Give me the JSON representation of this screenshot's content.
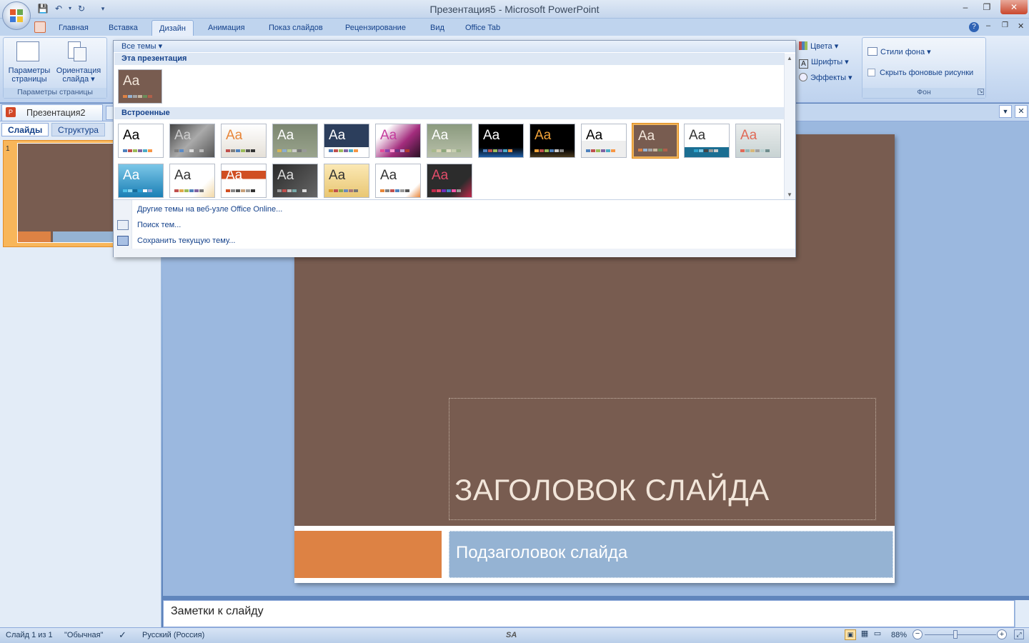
{
  "window": {
    "title": "Презентация5 - Microsoft PowerPoint"
  },
  "tabs": [
    "Главная",
    "Вставка",
    "Дизайн",
    "Анимация",
    "Показ слайдов",
    "Рецензирование",
    "Вид",
    "Office Tab"
  ],
  "ribbon": {
    "page_setup": {
      "btn1": "Параметры\nстраницы",
      "btn1_l1": "Параметры",
      "btn1_l2": "страницы",
      "btn2_l1": "Ориентация",
      "btn2_l2": "слайда ▾",
      "label": "Параметры страницы"
    },
    "theme_opts": {
      "colors": "Цвета ▾",
      "fonts": "Шрифты ▾",
      "effects": "Эффекты ▾"
    },
    "background": {
      "styles": "Стили фона ▾",
      "hide": "Скрыть фоновые рисунки",
      "label": "Фон"
    }
  },
  "gallery": {
    "header": "Все темы ▾",
    "section_this": "Эта презентация",
    "section_builtin": "Встроенные",
    "menu": [
      "Другие темы на веб-узле Office Online...",
      "Поиск тем...",
      "Сохранить текущую тему..."
    ],
    "theme_glyph": "Aa"
  },
  "doc_tab": "Презентация2",
  "left_tabs": {
    "slides": "Слайды",
    "outline": "Структура"
  },
  "thumb_number": "1",
  "slide": {
    "title": "ЗАГОЛОВОК СЛАЙДА",
    "subtitle": "Подзаголовок слайда"
  },
  "notes": "Заметки к слайду",
  "status": {
    "slide": "Слайд 1 из 1",
    "theme": "\"Обычная\"",
    "lang": "Русский (Россия)",
    "zoom": "88%"
  }
}
